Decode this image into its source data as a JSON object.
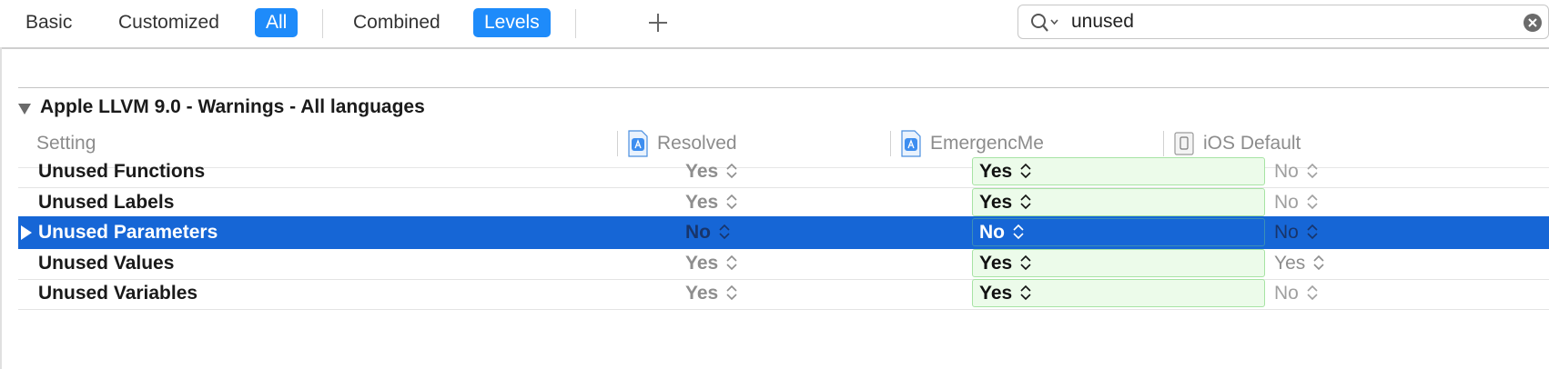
{
  "toolbar": {
    "tabs": [
      "Basic",
      "Customized",
      "All",
      "Combined",
      "Levels"
    ],
    "active_scope": "All",
    "active_view": "Levels",
    "add_icon": "plus-icon"
  },
  "search": {
    "value": "unused",
    "icon": "search-icon",
    "clear_icon": "clear-icon"
  },
  "section": {
    "title": "Apple LLVM 9.0 - Warnings - All languages",
    "expanded": true
  },
  "columns": {
    "setting": "Setting",
    "resolved": "Resolved",
    "target": "EmergencMe",
    "default": "iOS Default"
  },
  "rows": [
    {
      "name": "Unused Functions",
      "resolved": "Yes",
      "target": "Yes",
      "default": "No"
    },
    {
      "name": "Unused Labels",
      "resolved": "Yes",
      "target": "Yes",
      "default": "No"
    },
    {
      "name": "Unused Parameters",
      "resolved": "No",
      "target": "No",
      "default": "No",
      "selected": true
    },
    {
      "name": "Unused Values",
      "resolved": "Yes",
      "target": "Yes",
      "default": "Yes"
    },
    {
      "name": "Unused Variables",
      "resolved": "Yes",
      "target": "Yes",
      "default": "No"
    }
  ],
  "colors": {
    "accent": "#1e8bfa",
    "selection": "#1666d6",
    "target_cell": "#ecfbea",
    "target_border": "#a7e3a4"
  }
}
